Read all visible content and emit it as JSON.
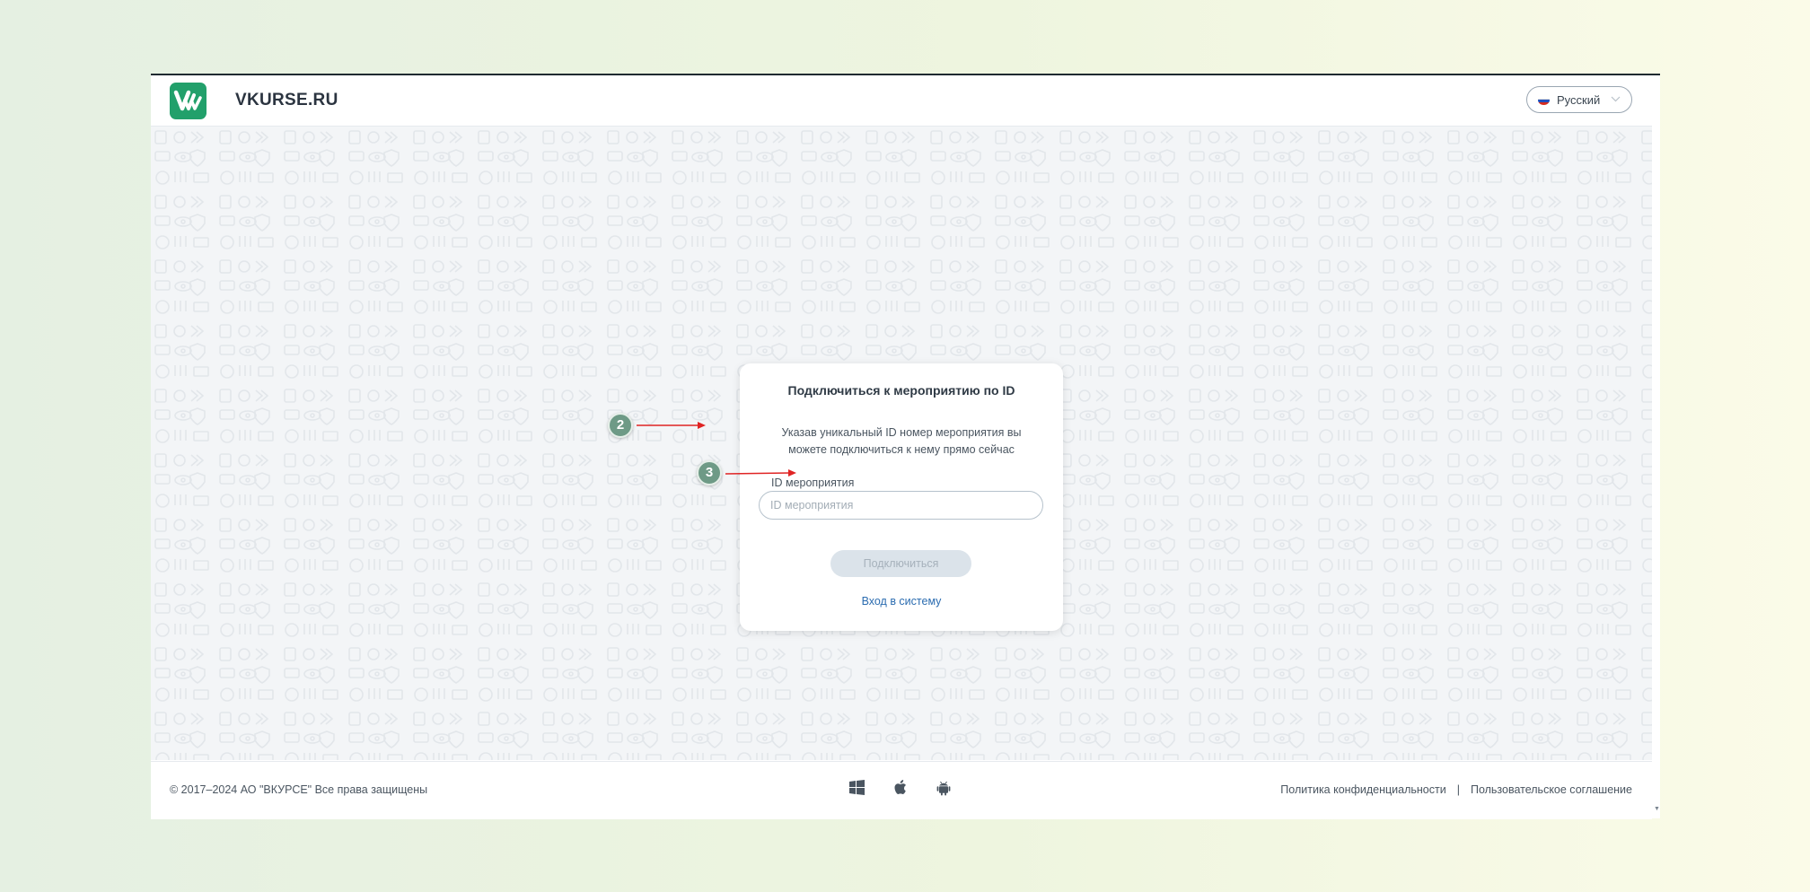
{
  "header": {
    "site_name": "VKURSE.RU",
    "language": "Русский"
  },
  "card": {
    "title": "Подключиться к мероприятию по ID",
    "description": "Указав уникальный ID номер мероприятия вы можете подключиться к нему прямо сейчас",
    "field_label": "ID мероприятия",
    "field_placeholder": "ID мероприятия",
    "field_value": "",
    "connect_button": "Подключиться",
    "login_link": "Вход в систему"
  },
  "footer": {
    "copyright": "© 2017–2024 АО \"ВКУРСЕ\" Все права защищены",
    "platforms": [
      "windows-icon",
      "apple-icon",
      "android-icon"
    ],
    "privacy_link": "Политика конфиденциальности",
    "separator": "|",
    "terms_link": "Пользовательское соглашение"
  },
  "callouts": [
    {
      "number": "2",
      "target": "event-id-input"
    },
    {
      "number": "3",
      "target": "connect-button"
    }
  ],
  "colors": {
    "brand_green": "#22a06b",
    "link_blue": "#2b6cb0",
    "callout_badge": "#6e9a86",
    "callout_arrow": "#e02424"
  }
}
